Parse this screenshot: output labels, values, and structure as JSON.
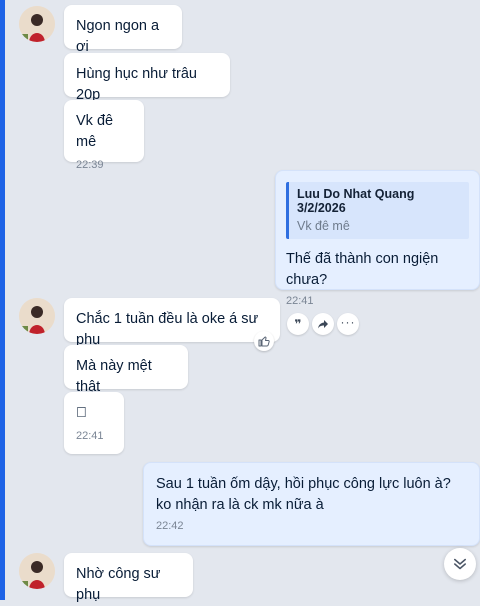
{
  "messages": [
    {
      "id": "m1",
      "text": "Ngon ngon a ơi"
    },
    {
      "id": "m2",
      "text": "Hùng hục như trâu 20p"
    },
    {
      "id": "m3",
      "text": "Vk đê mê",
      "time": "22:39"
    },
    {
      "id": "m4",
      "reply": {
        "author": "Luu Do Nhat Quang 3/2/2026",
        "text": "Vk đê mê"
      },
      "text": "Thế đã thành con ngiện chưa?",
      "time": "22:41"
    },
    {
      "id": "m5",
      "text": "Chắc 1 tuần đều là oke á sư phụ"
    },
    {
      "id": "m6",
      "text": "Mà này mệt thật"
    },
    {
      "id": "m7",
      "text": "􀀀",
      "time": "22:41"
    },
    {
      "id": "m8",
      "text": "Sau 1 tuần ốm dậy, hồi phục công lực luôn à? ko nhận ra là ck mk nữa à",
      "time": "22:42"
    },
    {
      "id": "m9",
      "text": "Nhờ công sư phụ"
    }
  ],
  "actions": {
    "quote_icon": "quote-icon",
    "forward_icon": "forward-icon",
    "more_icon": "more-icon",
    "like_icon": "thumbs-up-icon",
    "scroll_icon": "double-chevron-down-icon"
  },
  "colors": {
    "background": "#e3e7ee",
    "incoming_bubble": "#ffffff",
    "outgoing_bubble": "#e5efff",
    "accent": "#1e63e6"
  }
}
